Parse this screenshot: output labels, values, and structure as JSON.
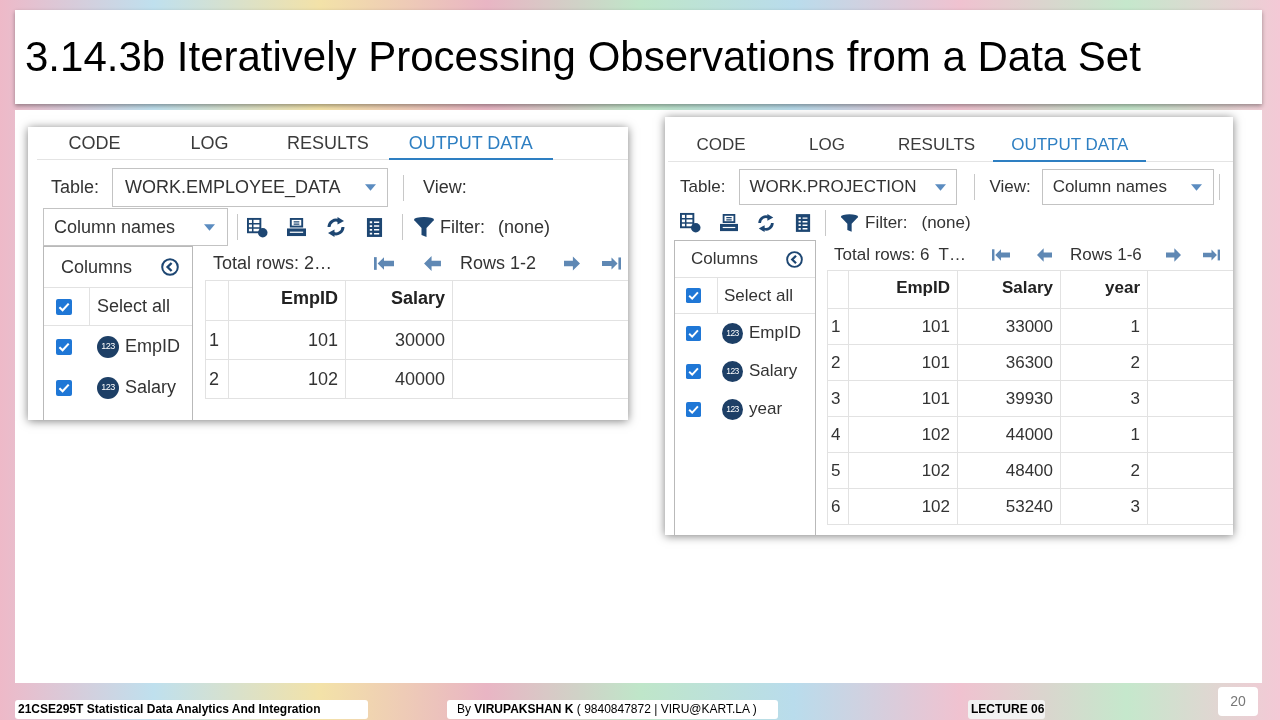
{
  "slide": {
    "title": "3.14.3b Iteratively Processing Observations from a Data Set"
  },
  "panels": [
    {
      "kind": "wrapped",
      "tabs": [
        {
          "label": "CODE",
          "selected": false
        },
        {
          "label": "LOG",
          "selected": false
        },
        {
          "label": "RESULTS",
          "selected": false
        },
        {
          "label": "OUTPUT DATA",
          "selected": true
        }
      ],
      "table": {
        "label": "Table:",
        "value": "WORK.EMPLOYEE_DATA"
      },
      "view": {
        "label": "View:",
        "value": "Column names"
      },
      "filter": {
        "label": "Filter:",
        "value": "(none)"
      },
      "columns_pane": {
        "title": "Columns",
        "items": [
          {
            "kind": "all",
            "label": "Select all",
            "checked": true
          },
          {
            "kind": "column",
            "badge": "123",
            "label": "EmpID",
            "checked": true
          },
          {
            "kind": "column",
            "badge": "123",
            "label": "Salary",
            "checked": true
          }
        ]
      },
      "total_rows": "Total rows: 2…",
      "rows_range": "Rows 1-2",
      "grid": {
        "columns": [
          "EmpID",
          "Salary"
        ],
        "rows": [
          {
            "number": "1",
            "cells": [
              "101",
              "30000"
            ]
          },
          {
            "number": "2",
            "cells": [
              "102",
              "40000"
            ]
          }
        ]
      }
    },
    {
      "kind": "inline",
      "tabs": [
        {
          "label": "CODE",
          "selected": false
        },
        {
          "label": "LOG",
          "selected": false
        },
        {
          "label": "RESULTS",
          "selected": false
        },
        {
          "label": "OUTPUT DATA",
          "selected": true
        }
      ],
      "table": {
        "label": "Table:",
        "value": "WORK.PROJECTION"
      },
      "view": {
        "label": "View:",
        "value": "Column names"
      },
      "filter": {
        "label": "Filter:",
        "value": "(none)"
      },
      "columns_pane": {
        "title": "Columns",
        "items": [
          {
            "kind": "all",
            "label": "Select all",
            "checked": true
          },
          {
            "kind": "column",
            "badge": "123",
            "label": "EmpID",
            "checked": true
          },
          {
            "kind": "column",
            "badge": "123",
            "label": "Salary",
            "checked": true
          },
          {
            "kind": "column",
            "badge": "123",
            "label": "year",
            "checked": true
          }
        ]
      },
      "total_rows": "Total rows: 6  T…",
      "rows_range": "Rows 1-6",
      "grid": {
        "columns": [
          "EmpID",
          "Salary",
          "year"
        ],
        "rows": [
          {
            "number": "1",
            "cells": [
              "101",
              "33000",
              "1"
            ]
          },
          {
            "number": "2",
            "cells": [
              "101",
              "36300",
              "2"
            ]
          },
          {
            "number": "3",
            "cells": [
              "101",
              "39930",
              "3"
            ]
          },
          {
            "number": "4",
            "cells": [
              "102",
              "44000",
              "1"
            ]
          },
          {
            "number": "5",
            "cells": [
              "102",
              "48400",
              "2"
            ]
          },
          {
            "number": "6",
            "cells": [
              "102",
              "53240",
              "3"
            ]
          }
        ]
      }
    }
  ],
  "footer": {
    "course": "21CSE295T Statistical Data Analytics And Integration",
    "author": "By **VIRUPAKSHAN K** ( 9840847872 | VIRU@KART.LA )",
    "lecture": "LECTURE 06",
    "page": "20"
  }
}
